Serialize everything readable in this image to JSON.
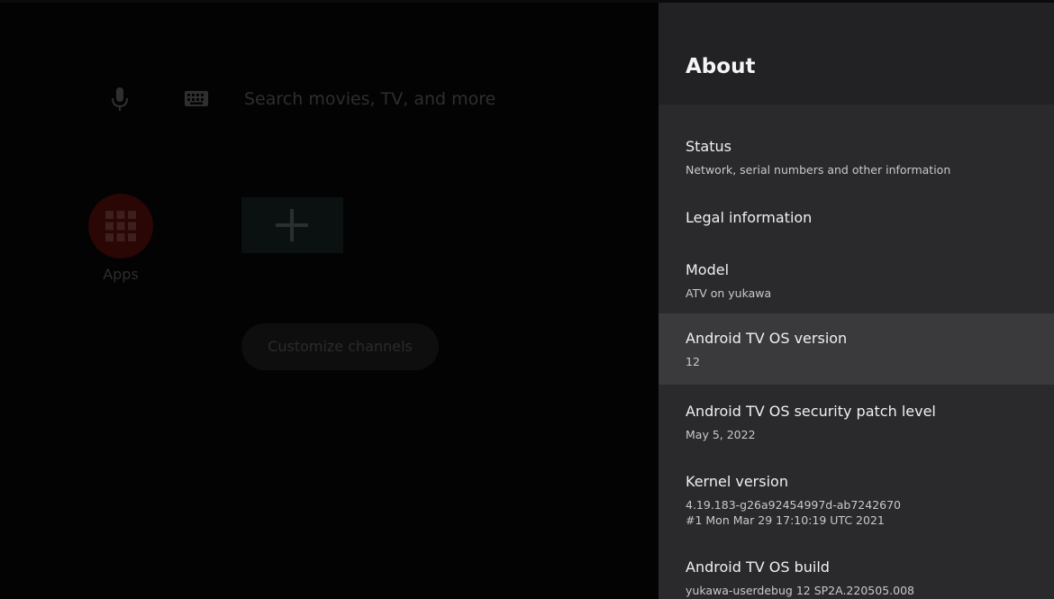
{
  "home": {
    "search_placeholder": "Search movies, TV, and more",
    "apps_label": "Apps",
    "customize_label": "Customize channels",
    "icons": {
      "mic": "microphone-icon",
      "keyboard": "keyboard-icon",
      "apps": "apps-grid-icon",
      "add": "plus-icon"
    },
    "colors": {
      "apps_circle": "#2a0605",
      "text_dim": "#2e2e2e"
    }
  },
  "panel": {
    "title": "About",
    "items": [
      {
        "title": "Status",
        "subtitle": "Network, serial numbers and other information"
      },
      {
        "title": "Legal information"
      },
      {
        "title": "Model",
        "subtitle": "ATV on yukawa"
      },
      {
        "title": "Android TV OS version",
        "subtitle": "12",
        "focused": true
      },
      {
        "title": "Android TV OS security patch level",
        "subtitle": "May 5, 2022"
      },
      {
        "title": "Kernel version",
        "subtitle": "4.19.183-g26a92454997d-ab7242670",
        "subtitle2": "#1 Mon Mar 29 17:10:19 UTC 2021"
      },
      {
        "title": "Android TV OS build",
        "subtitle": "yukawa-userdebug 12 SP2A.220505.008"
      }
    ],
    "colors": {
      "background": "#2a2a2d",
      "header": "#222224",
      "focused": "#3a3a3d"
    }
  }
}
